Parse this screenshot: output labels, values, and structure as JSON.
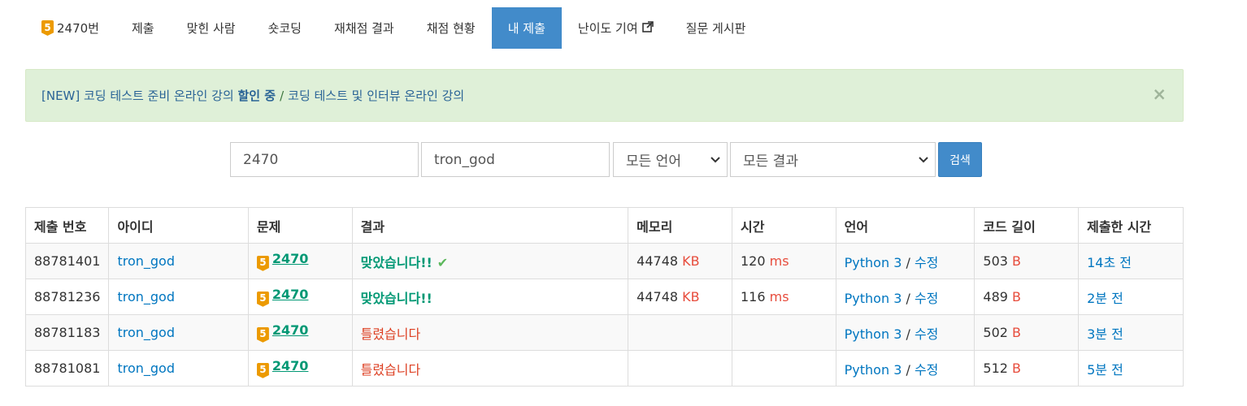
{
  "nav": {
    "problem_label": "2470번",
    "tier_label": "5",
    "items": [
      "제출",
      "맞힌 사람",
      "숏코딩",
      "재채점 결과",
      "채점 현황",
      "내 제출",
      "난이도 기여",
      "질문 게시판"
    ]
  },
  "alert": {
    "part1": "[NEW] 코딩 테스트 준비 온라인 강의 ",
    "part1_bold": "할인 중",
    "sep": "/",
    "part2": "코딩 테스트 및 인터뷰 온라인 강의",
    "close": "×"
  },
  "search": {
    "problem_value": "2470",
    "user_value": "tron_god",
    "language_selected": "모든 언어",
    "result_selected": "모든 결과",
    "button_label": "검색"
  },
  "table": {
    "headers": [
      "제출 번호",
      "아이디",
      "문제",
      "결과",
      "메모리",
      "시간",
      "언어",
      "코드 길이",
      "제출한 시간"
    ],
    "rows": [
      {
        "id": "88781401",
        "user": "tron_god",
        "tier": "5",
        "problem": "2470",
        "result": "맞았습니다!!",
        "check": "✔",
        "memory": "44748",
        "memory_unit": "KB",
        "time": "120",
        "time_unit": "ms",
        "lang": "Python 3",
        "lang_sep": "/",
        "edit": "수정",
        "length": "503",
        "length_unit": "B",
        "submitted": "14초 전"
      },
      {
        "id": "88781236",
        "user": "tron_god",
        "tier": "5",
        "problem": "2470",
        "result": "맞았습니다!!",
        "check": "",
        "memory": "44748",
        "memory_unit": "KB",
        "time": "116",
        "time_unit": "ms",
        "lang": "Python 3",
        "lang_sep": "/",
        "edit": "수정",
        "length": "489",
        "length_unit": "B",
        "submitted": "2분 전"
      },
      {
        "id": "88781183",
        "user": "tron_god",
        "tier": "5",
        "problem": "2470",
        "result": "틀렸습니다",
        "check": "",
        "memory": "",
        "memory_unit": "",
        "time": "",
        "time_unit": "",
        "lang": "Python 3",
        "lang_sep": "/",
        "edit": "수정",
        "length": "502",
        "length_unit": "B",
        "submitted": "3분 전"
      },
      {
        "id": "88781081",
        "user": "tron_god",
        "tier": "5",
        "problem": "2470",
        "result": "틀렸습니다",
        "check": "",
        "memory": "",
        "memory_unit": "",
        "time": "",
        "time_unit": "",
        "lang": "Python 3",
        "lang_sep": "/",
        "edit": "수정",
        "length": "512",
        "length_unit": "B",
        "submitted": "5분 전"
      }
    ]
  },
  "colors": {
    "primary": "#428bca",
    "tier_bronze_gold": "#ec9a00",
    "accepted": "#009874",
    "wrong": "#dd4124",
    "unit": "#e74c3c",
    "alert_bg": "#dff0d8"
  }
}
